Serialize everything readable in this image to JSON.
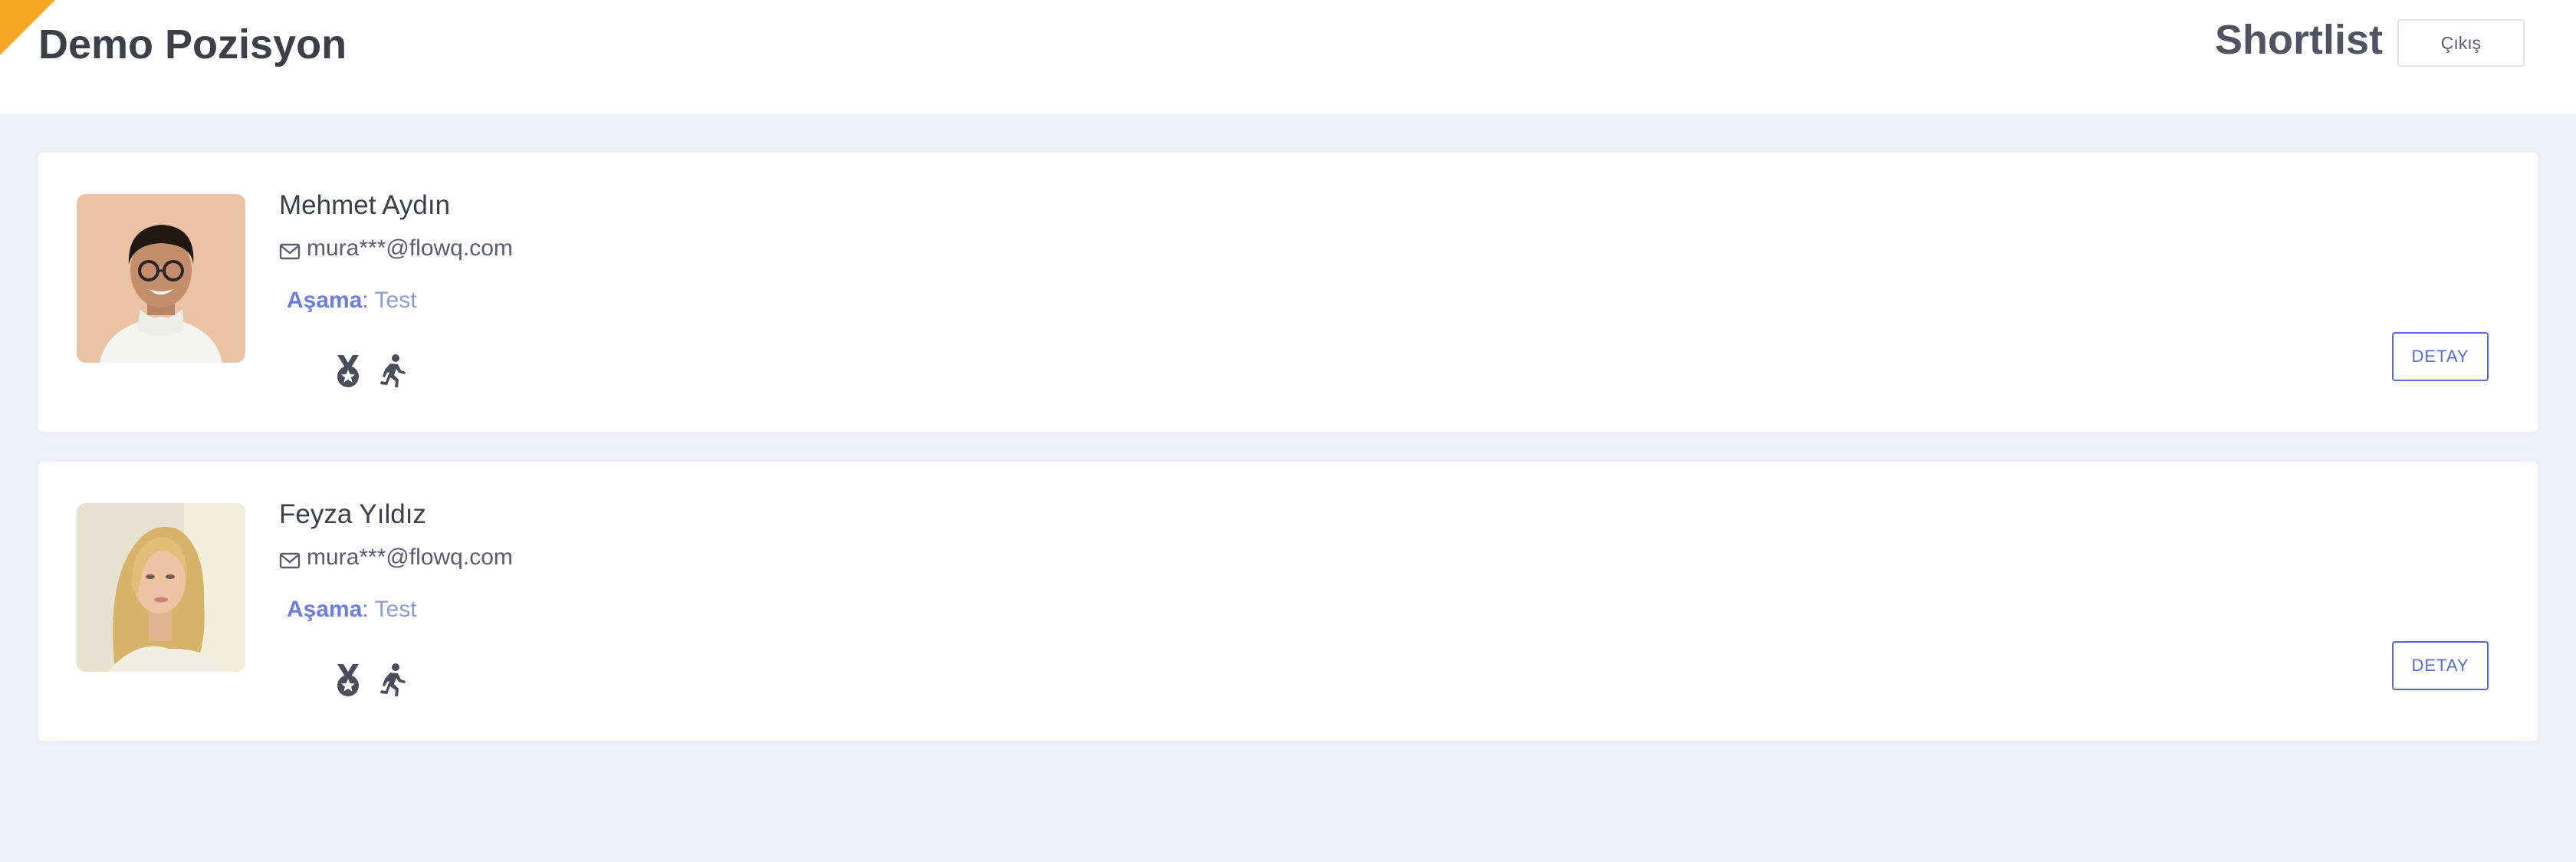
{
  "header": {
    "title": "Demo Pozisyon",
    "shortlist_label": "Shortlist",
    "logout_label": "Çıkış",
    "ribbon_color": "#f5a623"
  },
  "candidates": [
    {
      "name": "Mehmet Aydın",
      "email": "mura***@flowq.com",
      "stage_label": "Aşama",
      "stage_value": "Test",
      "badges": [
        "medal-icon",
        "runner-icon"
      ],
      "detail_label": "DETAY"
    },
    {
      "name": "Feyza Yıldız",
      "email": "mura***@flowq.com",
      "stage_label": "Aşama",
      "stage_value": "Test",
      "badges": [
        "medal-icon",
        "runner-icon"
      ],
      "detail_label": "DETAY"
    }
  ],
  "colors": {
    "accent": "#5867dd",
    "stage_text": "#6b7ee8",
    "background": "#f1f2f7"
  }
}
